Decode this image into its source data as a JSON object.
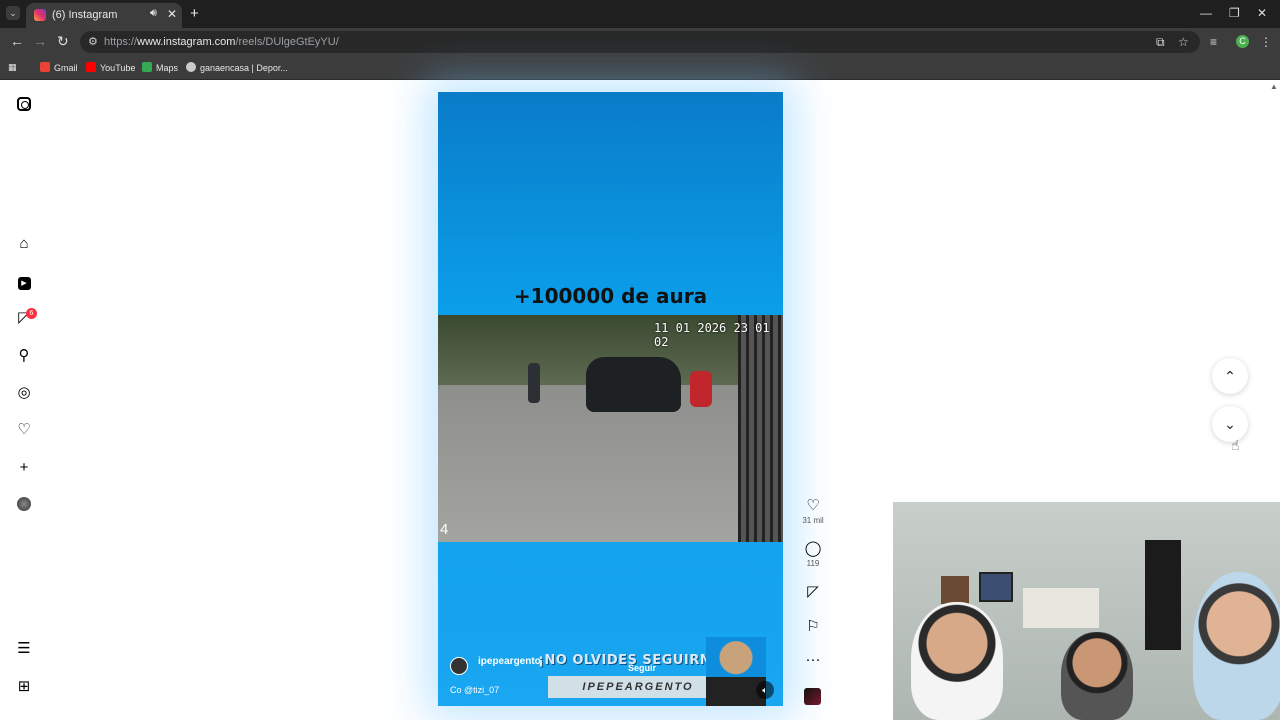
{
  "browser": {
    "tab_title": "(6) Instagram",
    "tab_sound_icon": "speaker-icon",
    "tab_close": "✕",
    "new_tab": "+",
    "url_prefix": "https://",
    "url_host": "www.instagram.com",
    "url_path": "/reels/DUlgeGtEyYU/",
    "profile_initial": "C",
    "bookmarks": [
      "Gmail",
      "YouTube",
      "Maps",
      "ganaencasa | Depor..."
    ]
  },
  "sidebar": {
    "notification_count": "6",
    "items": [
      "instagram-logo",
      "home",
      "reels",
      "messages",
      "search",
      "explore",
      "notifications",
      "create",
      "profile",
      "more",
      "also-from-meta"
    ]
  },
  "reel": {
    "caption": "+100000 de aura",
    "timestamp": "11 01 2026 23 01 02",
    "clip_number": "4",
    "username": "ipepeargento",
    "promo": "¡NO OLVIDES SEGUIRME!",
    "follow_label": "Seguir",
    "banner": "IPEPEARGENTO",
    "audio": "Co @tizi_07",
    "likes": "31 mil",
    "comments": "119",
    "colors": {
      "background": "#0b9ee9",
      "accent": "#ff3040"
    }
  },
  "navigation": {
    "up": "⌃",
    "down": "⌄"
  }
}
